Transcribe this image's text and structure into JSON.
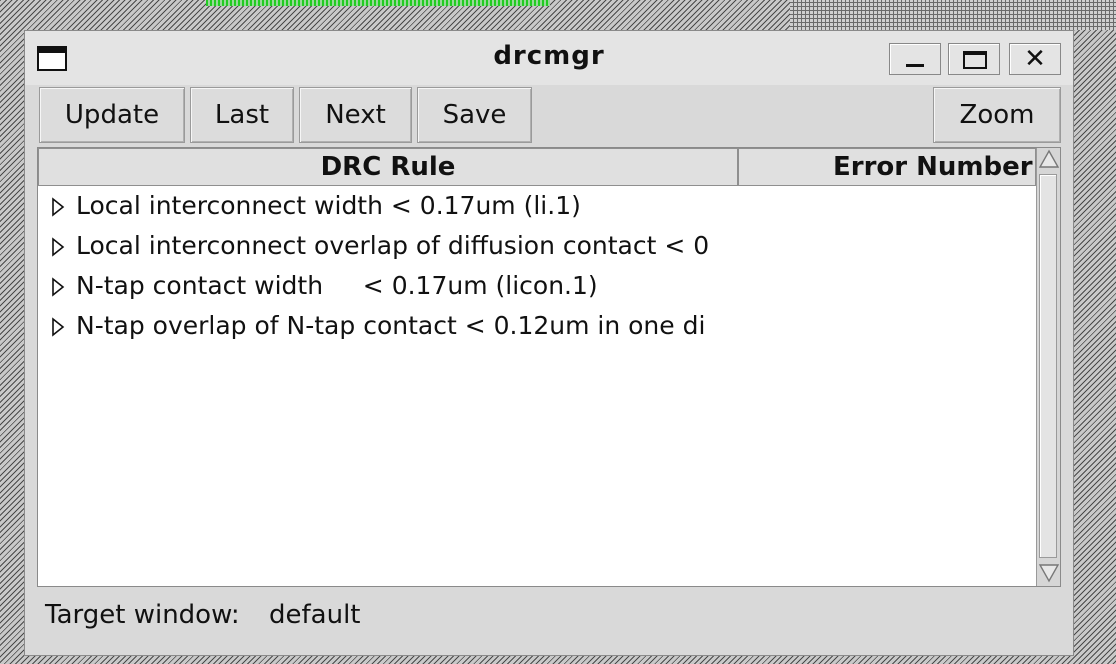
{
  "window": {
    "title": "drcmgr"
  },
  "toolbar": {
    "update_label": "Update",
    "last_label": "Last",
    "next_label": "Next",
    "save_label": "Save",
    "zoom_label": "Zoom"
  },
  "table": {
    "columns": [
      "DRC Rule",
      "Error Number"
    ],
    "rows": [
      {
        "label": "Local interconnect width < 0.17um (li.1)"
      },
      {
        "label": "Local interconnect overlap of diffusion contact < 0"
      },
      {
        "label": "N-tap contact width     < 0.17um (licon.1)"
      },
      {
        "label": "N-tap overlap of N-tap contact < 0.12um in one di"
      }
    ]
  },
  "status": {
    "label": "Target window:",
    "value": "default"
  },
  "icons": {
    "window_menu": "window-menu-icon",
    "minimize": "minimize-icon",
    "maximize": "maximize-icon",
    "close": "close-icon",
    "expand": "expand-triangle-icon",
    "scroll_up": "scroll-up-arrow-icon",
    "scroll_down": "scroll-down-arrow-icon"
  }
}
